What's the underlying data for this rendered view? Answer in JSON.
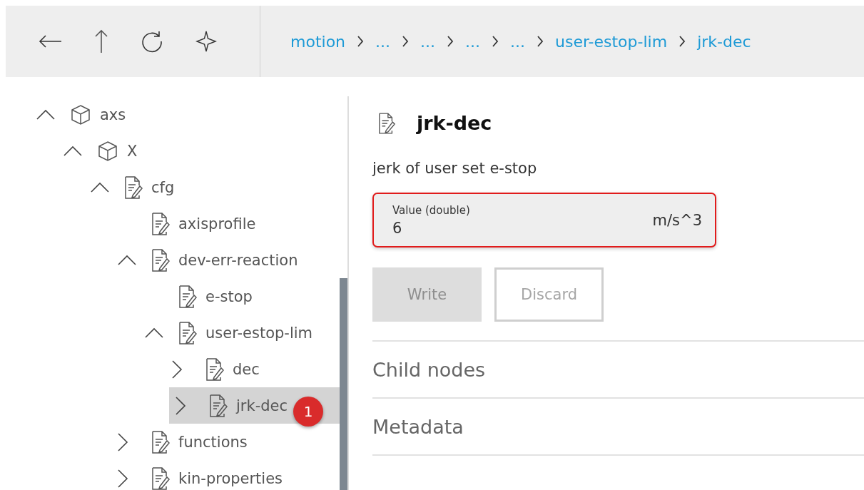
{
  "toolbar": {
    "breadcrumbs": [
      "motion",
      "...",
      "...",
      "...",
      "...",
      "user-estop-lim",
      "jrk-dec"
    ]
  },
  "tree": [
    {
      "label": "axs",
      "kind": "folder",
      "expanded": true,
      "selected": false,
      "children": [
        {
          "label": "X",
          "kind": "folder",
          "expanded": true,
          "selected": false,
          "children": [
            {
              "label": "cfg",
              "kind": "node",
              "expanded": true,
              "selected": false,
              "children": [
                {
                  "label": "axisprofile",
                  "kind": "node",
                  "selected": false
                },
                {
                  "label": "dev-err-reaction",
                  "kind": "node",
                  "expanded": true,
                  "selected": false,
                  "children": [
                    {
                      "label": "e-stop",
                      "kind": "node",
                      "selected": false
                    },
                    {
                      "label": "user-estop-lim",
                      "kind": "node",
                      "expanded": true,
                      "selected": false,
                      "children": [
                        {
                          "label": "dec",
                          "kind": "node",
                          "expanded": false,
                          "selected": false
                        },
                        {
                          "label": "jrk-dec",
                          "kind": "node",
                          "expanded": false,
                          "selected": true,
                          "badge": "1"
                        }
                      ]
                    }
                  ]
                },
                {
                  "label": "functions",
                  "kind": "node",
                  "expanded": false,
                  "selected": false
                },
                {
                  "label": "kin-properties",
                  "kind": "node",
                  "expanded": false,
                  "selected": false
                }
              ]
            }
          ]
        }
      ]
    }
  ],
  "detail": {
    "title": "jrk-dec",
    "description": "jerk of user set e-stop",
    "field": {
      "label": "Value (double)",
      "value": "6",
      "unit": "m/s^3",
      "error": true
    },
    "buttons": [
      {
        "label": "Write",
        "kind": "filled",
        "disabled": true
      },
      {
        "label": "Discard",
        "kind": "outline",
        "disabled": true
      }
    ],
    "sections": [
      "Child nodes",
      "Metadata"
    ]
  }
}
